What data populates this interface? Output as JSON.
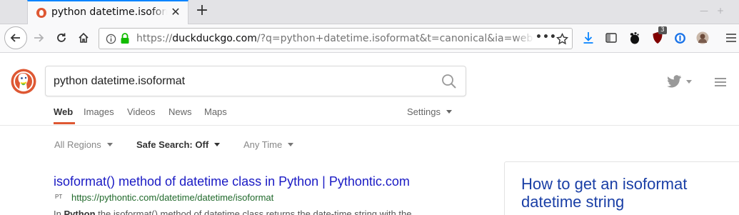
{
  "browser": {
    "tab": {
      "title": "python datetime.isoformat"
    },
    "url": {
      "scheme": "https://",
      "host": "duckduckgo.com",
      "path": "/?q=python+datetime.isoformat&t=canonical&ia=web"
    },
    "ublock_badge": "3"
  },
  "search": {
    "query": "python datetime.isoformat"
  },
  "header_tabs": [
    "Web",
    "Images",
    "Videos",
    "News",
    "Maps"
  ],
  "settings_label": "Settings",
  "filters": {
    "region": "All Regions",
    "safe_search": "Safe Search: Off",
    "time": "Any Time"
  },
  "result": {
    "title": "isoformat() method of datetime class in Python | Pythontic.com",
    "favicon_text": "PT",
    "url": "https://pythontic.com/datetime/datetime/isoformat",
    "snippet_prefix": "In ",
    "snippet_bold": "Python",
    "snippet_rest": " the isoformat() method of datetime class returns the date-time string with the"
  },
  "side_panel": {
    "title": "How to get an isoformat datetime string"
  },
  "colors": {
    "accent": "#0a84ff",
    "ddg_orange": "#de5833",
    "link": "#1a1ac4",
    "url_green": "#20692b",
    "secure_green": "#12bc00"
  },
  "icons": [
    "back-arrow-icon",
    "forward-arrow-icon",
    "reload-icon",
    "home-icon",
    "info-icon",
    "lock-icon",
    "page-actions-icon",
    "bookmark-star-icon",
    "download-icon",
    "sidebar-icon",
    "gnome-icon",
    "ublock-icon",
    "password-manager-icon",
    "avatar",
    "search-icon",
    "twitter-icon",
    "hamburger-icon"
  ]
}
